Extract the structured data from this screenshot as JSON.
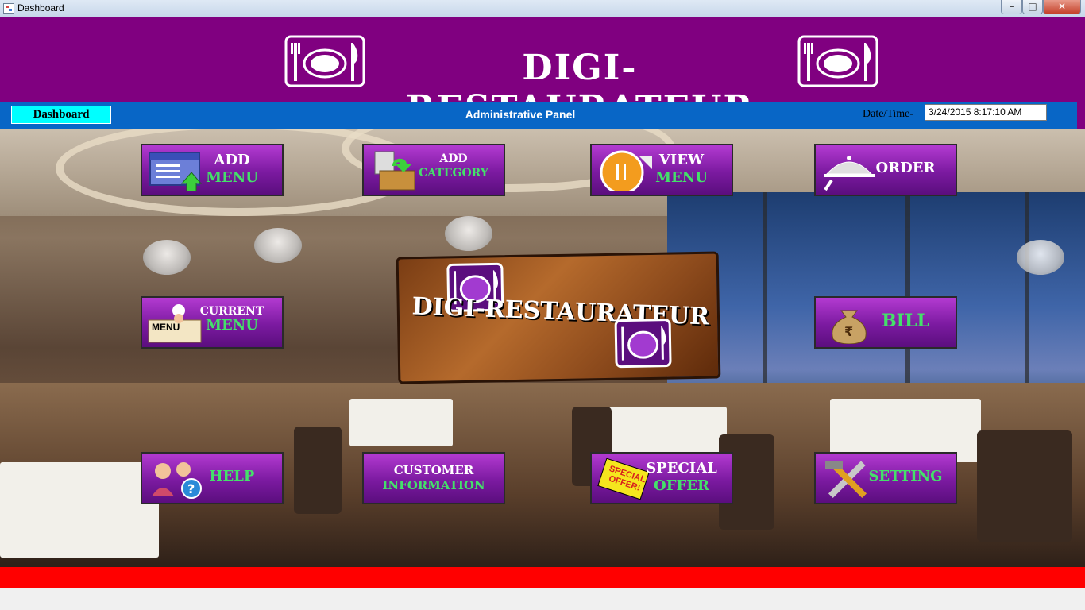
{
  "window": {
    "title": "Dashboard",
    "minimize": "–",
    "maximize": "□",
    "close": "✕"
  },
  "header": {
    "app_title": "DIGI-RESTAURATEUR"
  },
  "panel": {
    "dashboard_button": "Dashboard",
    "title": "Administrative Panel",
    "datetime_label": "Date/Time-",
    "datetime_value": "3/24/2015 8:17:10 AM"
  },
  "sign": {
    "title": "DIGI-RESTAURATEUR"
  },
  "tiles": {
    "add_menu": {
      "line1": "ADD",
      "line2": "MENU"
    },
    "add_category": {
      "line1": "ADD",
      "line2": "CATEGORY"
    },
    "view_menu": {
      "line1": "VIEW",
      "line2": "MENU"
    },
    "order": {
      "line1": "ORDER"
    },
    "current_menu": {
      "line1": "CURRENT",
      "line2": "MENU",
      "icon_text": "MENU"
    },
    "bill": {
      "line1": "BILL"
    },
    "help": {
      "line1": "HELP"
    },
    "customer_information": {
      "line1": "CUSTOMER",
      "line2": "INFORMATION"
    },
    "special_offer": {
      "line1": "SPECIAL",
      "line2": "OFFER",
      "icon_text": "SPECIAL OFFER!"
    },
    "setting": {
      "line1": "SETTING"
    }
  },
  "colors": {
    "header_bg": "#800080",
    "panel_bg": "#0866c6",
    "dashboard_button_bg": "#00ffff",
    "footer_bar": "#ff0000",
    "tile_label_green": "#44e06a"
  }
}
